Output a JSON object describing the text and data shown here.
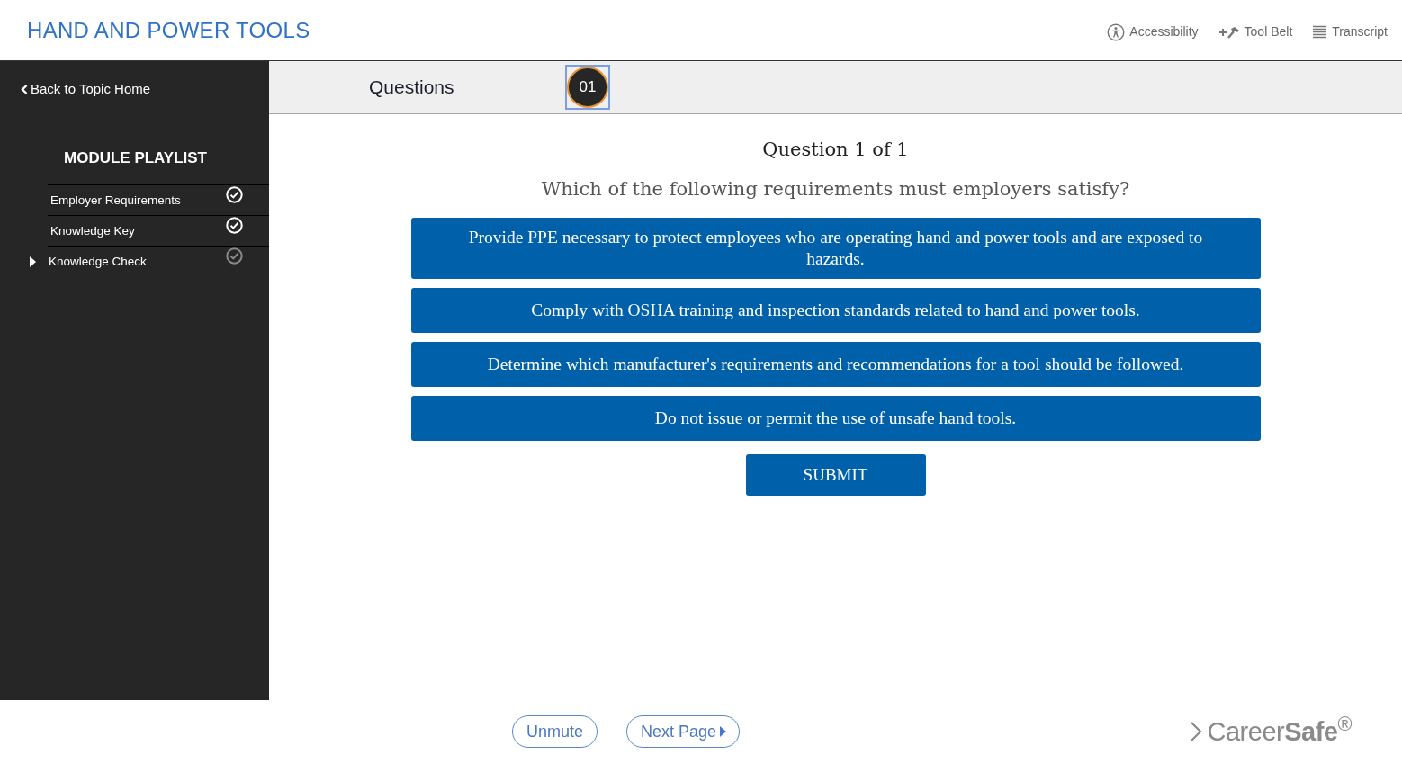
{
  "header": {
    "title": "HAND AND POWER TOOLS",
    "tools": [
      {
        "kind": "accessibility",
        "label": "Accessibility"
      },
      {
        "kind": "tool_belt",
        "label": "Tool Belt"
      },
      {
        "kind": "transcript",
        "label": "Transcript"
      }
    ]
  },
  "sidebar": {
    "back_link": "Back to Topic Home",
    "heading": "MODULE PLAYLIST",
    "items": [
      {
        "label": "Employer Requirements",
        "completed": true,
        "selected": false
      },
      {
        "label": "Knowledge Key",
        "completed": true,
        "selected": false
      },
      {
        "label": "Knowledge Check",
        "completed": false,
        "selected": true
      }
    ]
  },
  "questions_bar": {
    "title": "Questions",
    "badges": [
      {
        "label": "01",
        "selected": true
      }
    ]
  },
  "question": {
    "counter": "Question 1 of 1",
    "prompt": "Which of the following requirements must employers satisfy?",
    "answers": [
      "Provide PPE necessary to protect employees who are operating hand and power tools and are exposed to hazards.",
      "Comply with OSHA training and inspection standards related to hand and power tools.",
      "Determine which manufacturer's requirements and recommendations for a tool should be followed.",
      "Do not issue or permit the use of unsafe hand tools."
    ],
    "submit": "SUBMIT"
  },
  "footer": {
    "buttons": [
      {
        "kind": "plain",
        "label": "Unmute"
      },
      {
        "kind": "next",
        "label": "Next Page"
      }
    ],
    "logo": "Career**Safe**$^{®}$"
  }
}
